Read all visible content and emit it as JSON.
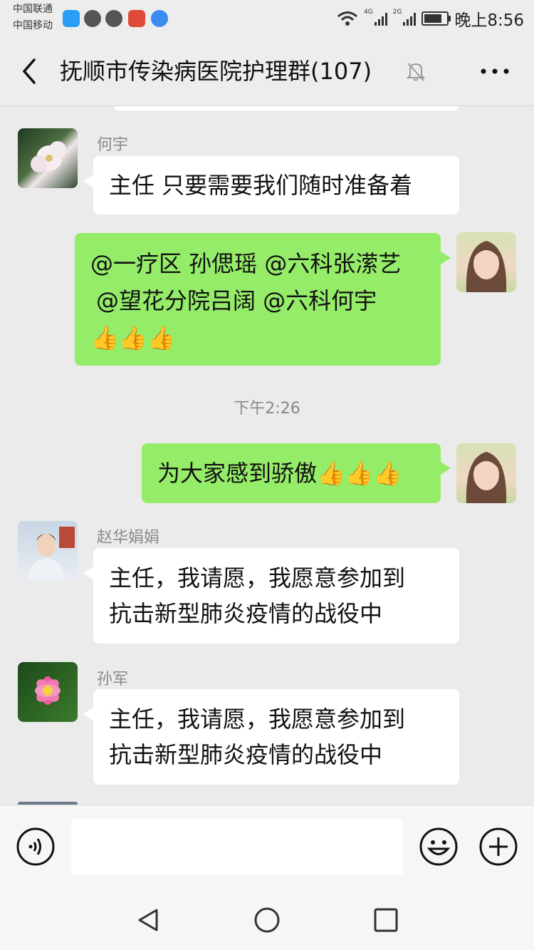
{
  "status": {
    "carrier1": "中国联通",
    "carrier2": "中国移动",
    "net1": "4G",
    "net2": "2G",
    "time": "晚上8:56"
  },
  "header": {
    "title": "抚顺市传染病医院护理群(107)"
  },
  "messages": [
    {
      "sender": "何宇",
      "text": "主任   只要需要我们随时准备着"
    },
    {
      "line1": "@一疗区  孙偲瑶  @六科张潆艺",
      "line2": "@望花分院吕阔  @六科何宇",
      "line3": "👍👍👍"
    },
    {
      "timestamp": "下午2:26"
    },
    {
      "text": "为大家感到骄傲👍👍👍"
    },
    {
      "sender": "赵华娟娟",
      "line1": "主任，我请愿，我愿意参加到",
      "line2": "抗击新型肺炎疫情的战役中"
    },
    {
      "sender": "孙军",
      "line1": "主任，我请愿，我愿意参加到",
      "line2": "抗击新型肺炎疫情的战役中"
    }
  ],
  "colors": {
    "outgoing_bubble": "#95ec69",
    "incoming_bubble": "#ffffff",
    "background": "#ebebeb"
  }
}
